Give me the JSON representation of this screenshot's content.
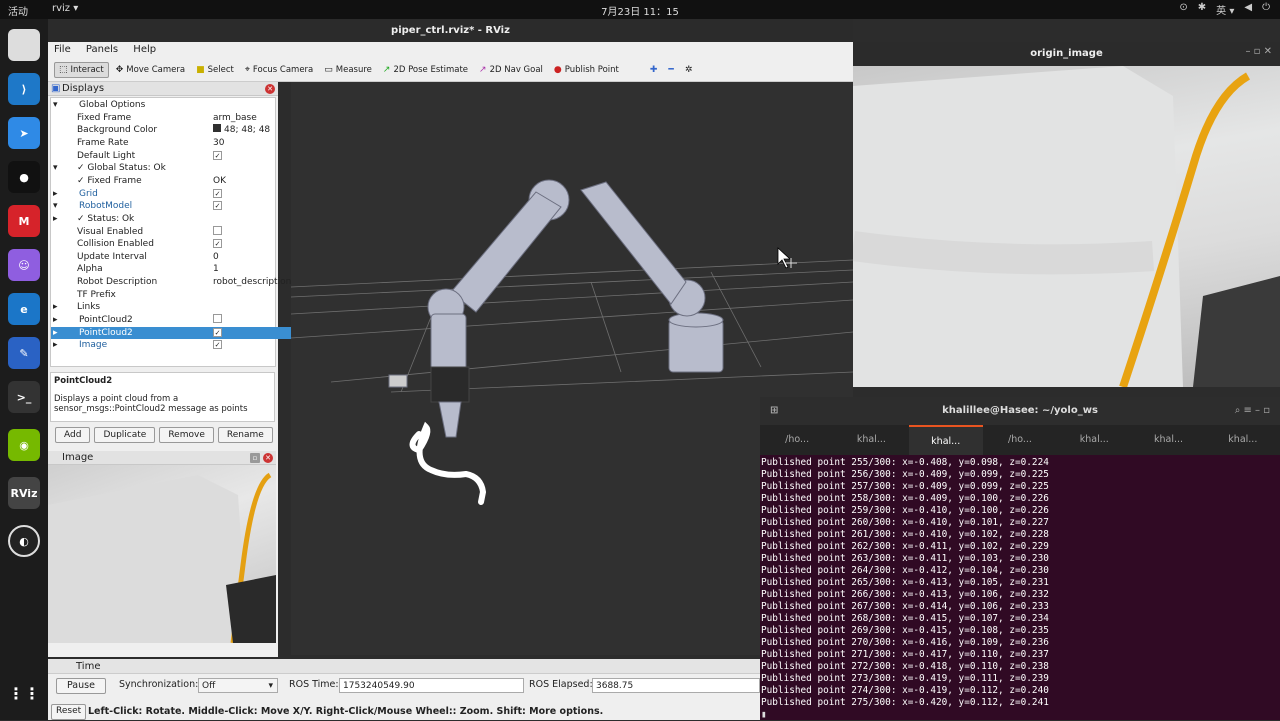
{
  "topbar": {
    "activities": "活动",
    "app": "rviz ▾",
    "clock": "7月23日  11：15",
    "lang": "英 ▾"
  },
  "rviz": {
    "title": "piper_ctrl.rviz* - RViz",
    "menu": [
      "File",
      "Panels",
      "Help"
    ],
    "tools": [
      "Interact",
      "Move Camera",
      "Select",
      "Focus Camera",
      "Measure",
      "2D Pose Estimate",
      "2D Nav Goal",
      "Publish Point"
    ],
    "displays": {
      "header": "Displays",
      "rows": [
        {
          "label": "Global Options",
          "value": "",
          "indent": 0,
          "arrow": "▾"
        },
        {
          "label": "Fixed Frame",
          "value": "arm_base",
          "indent": 2
        },
        {
          "label": "Background Color",
          "value": "48; 48; 48",
          "indent": 2
        },
        {
          "label": "Frame Rate",
          "value": "30",
          "indent": 2
        },
        {
          "label": "Default Light",
          "value": "✓",
          "indent": 2
        },
        {
          "label": "✓ Global Status: Ok",
          "value": "",
          "indent": 1,
          "arrow": "▾"
        },
        {
          "label": "✓ Fixed Frame",
          "value": "OK",
          "indent": 2
        },
        {
          "label": "Grid",
          "value": "✓",
          "indent": 0,
          "arrow": "▸",
          "blue": true
        },
        {
          "label": "RobotModel",
          "value": "✓",
          "indent": 0,
          "arrow": "▾",
          "blue": true
        },
        {
          "label": "✓ Status: Ok",
          "value": "",
          "indent": 1,
          "arrow": "▸"
        },
        {
          "label": "Visual Enabled",
          "value": "",
          "indent": 2
        },
        {
          "label": "Collision Enabled",
          "value": "✓",
          "indent": 2
        },
        {
          "label": "Update Interval",
          "value": "0",
          "indent": 2
        },
        {
          "label": "Alpha",
          "value": "1",
          "indent": 2
        },
        {
          "label": "Robot Description",
          "value": "robot_description",
          "indent": 2
        },
        {
          "label": "TF Prefix",
          "value": "",
          "indent": 2
        },
        {
          "label": "Links",
          "value": "",
          "indent": 1,
          "arrow": "▸"
        },
        {
          "label": "PointCloud2",
          "value": "",
          "indent": 0,
          "arrow": "▸"
        },
        {
          "label": "PointCloud2",
          "value": "✓",
          "indent": 0,
          "arrow": "▸",
          "selected": true
        },
        {
          "label": "Image",
          "value": "✓",
          "indent": 0,
          "arrow": "▸",
          "blue": true
        }
      ]
    },
    "description": {
      "title": "PointCloud2",
      "text": "Displays a point cloud from a sensor_msgs::PointCloud2 message as points"
    },
    "buttons": [
      "Add",
      "Duplicate",
      "Remove",
      "Rename"
    ],
    "image_panel": "Image",
    "time": {
      "header": "Time",
      "pause": "Pause",
      "sync_label": "Synchronization:",
      "sync_value": "Off",
      "ros_time_label": "ROS Time:",
      "ros_time": "1753240549.90",
      "ros_elapsed_label": "ROS Elapsed:",
      "ros_elapsed": "3688.75",
      "reset": "Reset",
      "hint": "Left-Click: Rotate. Middle-Click: Move X/Y. Right-Click/Mouse Wheel:: Zoom. Shift: More options."
    }
  },
  "origin_image": {
    "title": "origin_image"
  },
  "terminal": {
    "title": "khalillee@Hasee: ~/yolo_ws",
    "tabs": [
      "/ho...",
      "khal...",
      "khal...",
      "/ho...",
      "khal...",
      "khal...",
      "khal..."
    ],
    "lines": [
      "Published point 255/300: x=-0.408, y=0.098, z=0.224",
      "Published point 256/300: x=-0.409, y=0.099, z=0.225",
      "Published point 257/300: x=-0.409, y=0.099, z=0.225",
      "Published point 258/300: x=-0.409, y=0.100, z=0.226",
      "Published point 259/300: x=-0.410, y=0.100, z=0.226",
      "Published point 260/300: x=-0.410, y=0.101, z=0.227",
      "Published point 261/300: x=-0.410, y=0.102, z=0.228",
      "Published point 262/300: x=-0.411, y=0.102, z=0.229",
      "Published point 263/300: x=-0.411, y=0.103, z=0.230",
      "Published point 264/300: x=-0.412, y=0.104, z=0.230",
      "Published point 265/300: x=-0.413, y=0.105, z=0.231",
      "Published point 266/300: x=-0.413, y=0.106, z=0.232",
      "Published point 267/300: x=-0.414, y=0.106, z=0.233",
      "Published point 268/300: x=-0.415, y=0.107, z=0.234",
      "Published point 269/300: x=-0.415, y=0.108, z=0.235",
      "Published point 270/300: x=-0.416, y=0.109, z=0.236",
      "Published point 271/300: x=-0.417, y=0.110, z=0.237",
      "Published point 272/300: x=-0.418, y=0.110, z=0.238",
      "Published point 273/300: x=-0.419, y=0.111, z=0.239",
      "Published point 274/300: x=-0.419, y=0.112, z=0.240",
      "Published point 275/300: x=-0.420, y=0.112, z=0.241"
    ]
  },
  "colors": {
    "accent": "#e95420",
    "selection": "#3a8ed1",
    "terminal_bg": "#300a24",
    "viewport_bg": "#303030",
    "bg_swatch": "#303030"
  }
}
